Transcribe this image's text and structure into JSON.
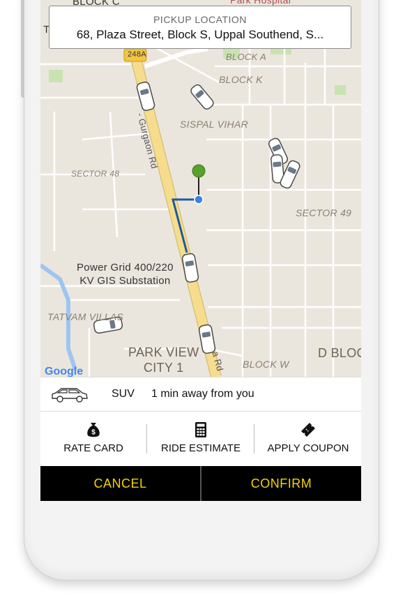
{
  "pickup": {
    "label": "PICKUP LOCATION",
    "address": "68, Plaza Street, Block S, Uppal Southend, S..."
  },
  "map": {
    "labels": {
      "block_a": "BLOCK A",
      "block_k": "BLOCK K",
      "sispal_vihar": "SISPAL VIHAR",
      "sector_48": "SECTOR 48",
      "sector_49": "SECTOR 49",
      "power_grid": "Power Grid 400/220",
      "kv_gis": "KV GIS Substation",
      "tatvam": "TATVAM VILLAS",
      "park_view": "PARK VIEW",
      "city_1": "CITY 1",
      "d_block": "D BLOC",
      "block_w": "BLOCK W",
      "highway": "248A",
      "road_name": "- Gurgaon Rd",
      "road_name_2": "a Rd",
      "top_cut": "BLOCK C",
      "top_left": "T",
      "park_hospital": "Park Hospital",
      "google": "Google"
    },
    "colors": {
      "pin": "#5aa02c",
      "route": "#1d5a9c",
      "dot": "#3b82e0",
      "main_road": "#f6dd8e",
      "water": "#9ec5f0"
    }
  },
  "vehicle": {
    "icon": "suv-car-icon",
    "type": "SUV",
    "eta": "1 min away from you"
  },
  "actions": [
    {
      "label": "RATE CARD",
      "icon": "money-bag-icon"
    },
    {
      "label": "RIDE ESTIMATE",
      "icon": "calculator-icon"
    },
    {
      "label": "APPLY COUPON",
      "icon": "coupon-ticket-icon"
    }
  ],
  "buttons": {
    "cancel": "CANCEL",
    "confirm": "CONFIRM",
    "accent": "#f5d300"
  }
}
